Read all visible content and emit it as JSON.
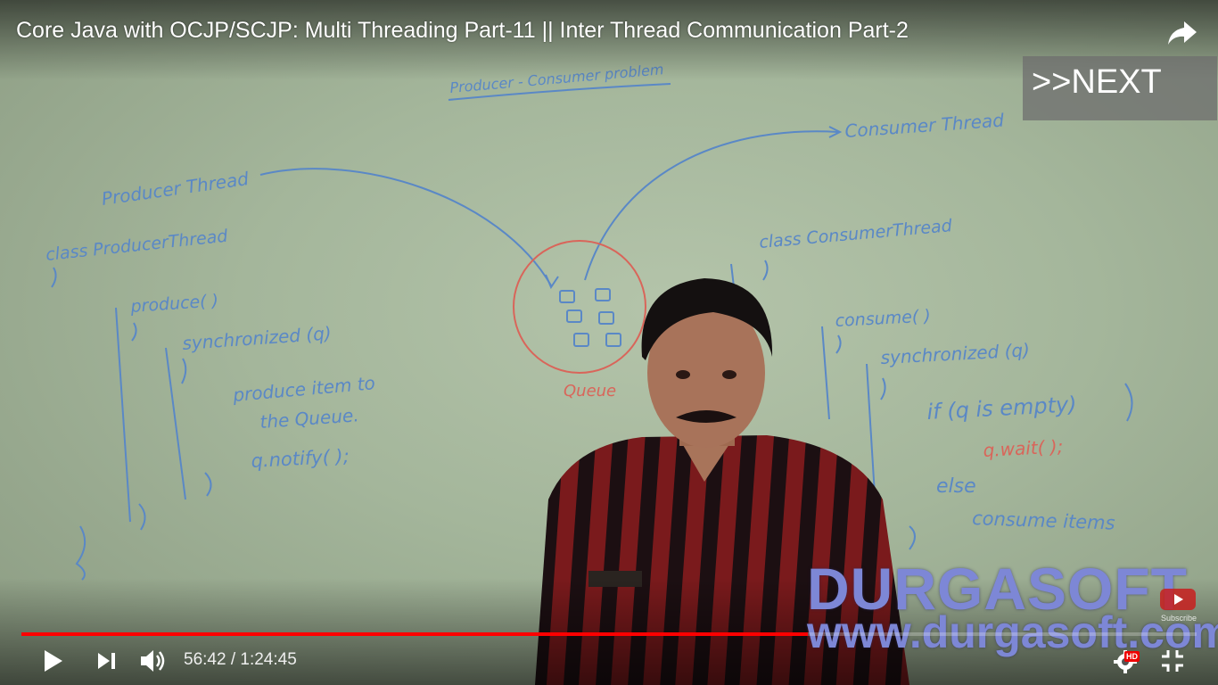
{
  "video": {
    "title": "Core Java with OCJP/SCJP: Multi Threading Part-11 || Inter Thread Communication Part-2",
    "next_label": ">>NEXT",
    "watermark_brand": "DURGASOFT",
    "watermark_url": "www.durgasoft.com",
    "subscribe_label": "Subscribe"
  },
  "whiteboard": {
    "heading": "Producer - Consumer problem",
    "producer_thread": "Producer Thread",
    "consumer_thread": "Consumer Thread",
    "producer_class": "class ProducerThread",
    "producer_method": "produce( )",
    "producer_sync": "synchronized (q)",
    "producer_body_1": "produce item to",
    "producer_body_2": "the Queue.",
    "producer_notify": "q.notify( );",
    "queue_label": "Queue",
    "consumer_class": "class ConsumerThread",
    "consumer_method": "consume( )",
    "consumer_sync": "synchronized (q)",
    "consumer_if": "if (q is empty)",
    "consumer_wait": "q.wait( );",
    "consumer_else": "else",
    "consumer_item": "consume items"
  },
  "player": {
    "current_time": "56:42",
    "duration": "1:24:45",
    "time_display": "56:42 / 1:24:45",
    "progress": 0.669,
    "hd_badge": "HD"
  },
  "colors": {
    "progress": "#ff0000",
    "marker_blue": "#5b8fcf",
    "marker_red": "#d9655a"
  },
  "icons": {
    "play": "play-icon",
    "next": "skip-next-icon",
    "volume": "volume-icon",
    "share": "share-icon",
    "settings": "gear-icon",
    "fullscreen": "exit-fullscreen-icon"
  }
}
